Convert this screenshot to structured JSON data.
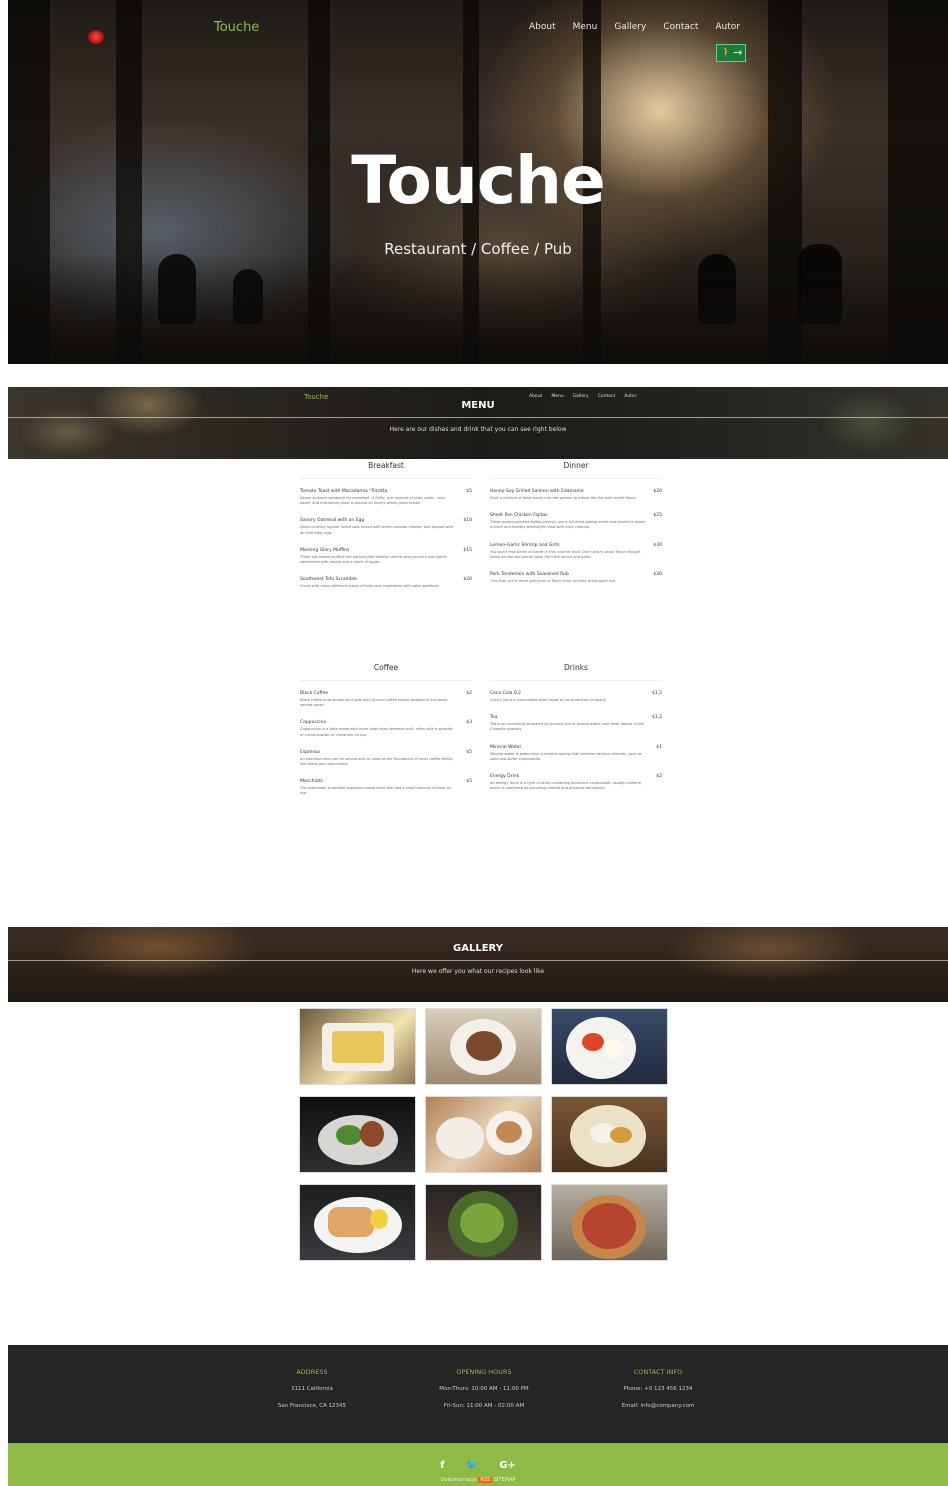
{
  "nav": {
    "brand": "Touche",
    "items": [
      "About",
      "Menu",
      "Gallery",
      "Contact",
      "Autor"
    ]
  },
  "hero": {
    "title": "Touche",
    "subtitle": "Restaurant / Coffee / Pub"
  },
  "menu_section": {
    "title": "MENU",
    "subtitle": "Here are our dishes and drink that you can see right below",
    "categories": [
      {
        "name": "Breakfast",
        "items": [
          {
            "name": "Tomato Toast with Macadamia “Ricotta",
            "price": "$5",
            "desc": "Vegan summer sandwich for breakfast. A fluffy, rich mixture of nuts, garlic, miso paste, and nutritional yeast is spread on hearty whole-grain bread."
          },
          {
            "name": "Savory Oatmeal with an Egg",
            "price": "$10",
            "desc": "Quick-cooking regular rolled oats mixed with white cheddar cheese, and topped with an over-easy egg."
          },
          {
            "name": "Morning Glory Muffins",
            "price": "$15",
            "desc": "These oat-based muffins are packed with healthy carrots and zucchini and lightly sweetened with raisins and a pinch of sugar."
          },
          {
            "name": "Southwest Tofu Scramble",
            "price": "$20",
            "desc": "Foods with many different types of fruits and vegetables with salty additives."
          }
        ]
      },
      {
        "name": "Dinner",
        "items": [
          {
            "name": "Honey-Soy Grilled Salmon with Edamame",
            "price": "$20",
            "desc": "Stuff a mixture of fresh herbs into the salmon to infuse the fish with bright flavor."
          },
          {
            "name": "Sheet Pan Chicken Fajitas",
            "price": "$25",
            "desc": "These protein-packed fajitas cleverly use a foil-lined baking sheet and broiler to make a quick and healthy weeknight meal with easy cleanup."
          },
          {
            "name": "Lemon-Garlic Shrimp and Grits",
            "price": "$30",
            "desc": "You won't find sticks of butter in this comfort food. Don't worry about flavor though, these shrimp are plenty tasty from the lemon and garlic."
          },
          {
            "name": "Pork Tenderloin with Seasoned Rub",
            "price": "$30",
            "desc": "This lean cut of meat gets tons of flavor from an easy dried-spice rub."
          }
        ]
      },
      {
        "name": "Coffee",
        "items": [
          {
            "name": "Black Coffee",
            "price": "$2",
            "desc": "Black coffee is as simple as it gets with ground coffee beans steeped in hot water, served warm."
          },
          {
            "name": "Cappuccino",
            "price": "$3",
            "desc": "Cappuccino is a latte made with more foam than steamed milk, often with a sprinkle of cocoa powder or cinnamon on top."
          },
          {
            "name": "Espresso",
            "price": "$5",
            "desc": "An espresso shot can be served solo or used as the foundation of most coffee drinks, like lattes and macchiatos."
          },
          {
            "name": "Macchiato",
            "price": "$5",
            "desc": "The macchiato is another espresso-based drink that has a small amount of foam on top."
          }
        ]
      },
      {
        "name": "Drinks",
        "items": [
          {
            "name": "Coca Cola 0,2",
            "price": "$1,5",
            "desc": "Coca-Cola is a carbonated drink made by an American company."
          },
          {
            "name": "Tea",
            "price": "$1,2",
            "desc": "Tea is an commonly prepared by pouring hot or boiling water over fresh leaves of the Camellia sinensis."
          },
          {
            "name": "Mineral Water",
            "price": "$1",
            "desc": "Mineral water is water from a mineral spring that contains various minerals, such as salts and sulfur compounds."
          },
          {
            "name": "Energy Drink",
            "price": "$2",
            "desc": "An energy drink is a type of drink containing stimulant compounds, usually caffeine, which is marketed as providing mental and physical stimulation."
          }
        ]
      }
    ]
  },
  "gallery_section": {
    "title": "GALLERY",
    "subtitle": "Here we offer you what our recipes look like"
  },
  "footer": {
    "address": {
      "head": "ADDRESS",
      "line1": "1111 California",
      "line2": "San Francisco, CA 12345"
    },
    "hours": {
      "head": "OPENING HOURS",
      "line1": "Mon-Thurs: 10:00 AM - 11:00 PM",
      "line2": "Fri-Sun: 11:00 AM - 02:00 AM"
    },
    "contact": {
      "head": "CONTACT INFO",
      "line1": "Phone: +0 123 456 1234",
      "line2": "Email: info@company.com"
    },
    "socials": [
      "f",
      "🐦",
      "G+"
    ],
    "links": {
      "doc": "Dokumentacja",
      "rss": "RSS",
      "sitemap": "SITEMAP"
    }
  },
  "colors": {
    "accent": "#8dbb46",
    "footer_dark": "#252525"
  }
}
